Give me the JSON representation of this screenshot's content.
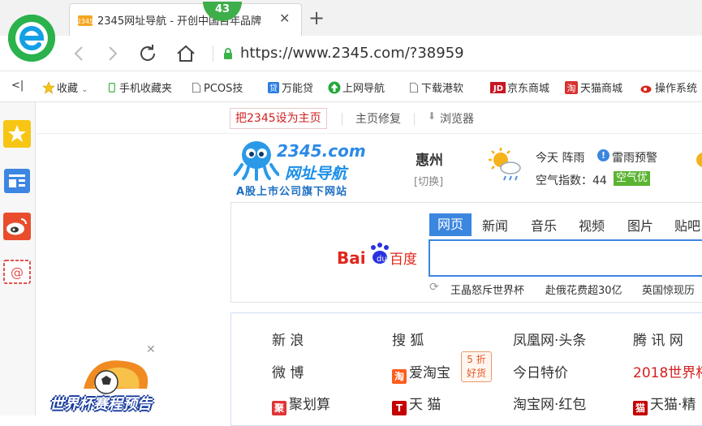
{
  "tab": {
    "title": "2345网址导航 - 开创中国百年品牌",
    "badge": "43",
    "close_icon": "close-icon",
    "new_tab_icon": "plus-icon"
  },
  "address_bar": {
    "url": "https://www.2345.com/?38959",
    "back_icon": "chevron-left-icon",
    "forward_icon": "chevron-right-icon",
    "refresh_icon": "refresh-icon",
    "home_icon": "home-icon"
  },
  "bookmarks": {
    "collapse": "<|",
    "items": [
      "收藏",
      "手机收藏夹",
      "PCOS技",
      "万能贷",
      "上网导航",
      "下载港软",
      "京东商城",
      "天猫商城",
      "操作系统"
    ]
  },
  "page": {
    "set_home": "把2345设为主页",
    "home_repair": "主页修复",
    "browser": "浏览器",
    "brand_title": "2345.com",
    "brand_name": "网址导航",
    "brand_sub": "A股上市公司旗下网站",
    "city": "惠州",
    "city_switch": "[切换]",
    "weather_today": "今天 阵雨",
    "weather_alert": "雷雨预警",
    "aqi_label": "空气指数：44",
    "aqi_level": "空气优",
    "search_tabs": [
      "网页",
      "新闻",
      "音乐",
      "视频",
      "图片",
      "贴吧"
    ],
    "search_logo": "Bai百度",
    "hot_searches": [
      "王晶怒斥世界杯",
      "赴俄花费超30亿",
      "英国惊现历"
    ],
    "links": {
      "col1": [
        "新 浪",
        "微 博",
        "聚划算"
      ],
      "col2": [
        "搜 狐",
        "爱淘宝",
        "天 猫"
      ],
      "col3": [
        "凤凰网·头条",
        "今日特价",
        "淘宝网·红包"
      ],
      "col4": [
        "腾 讯 网",
        "2018世界杯",
        "天猫·精"
      ]
    },
    "promo_badge": [
      "5 折",
      "好货"
    ],
    "ad_text": "世界杯赛程预告"
  }
}
